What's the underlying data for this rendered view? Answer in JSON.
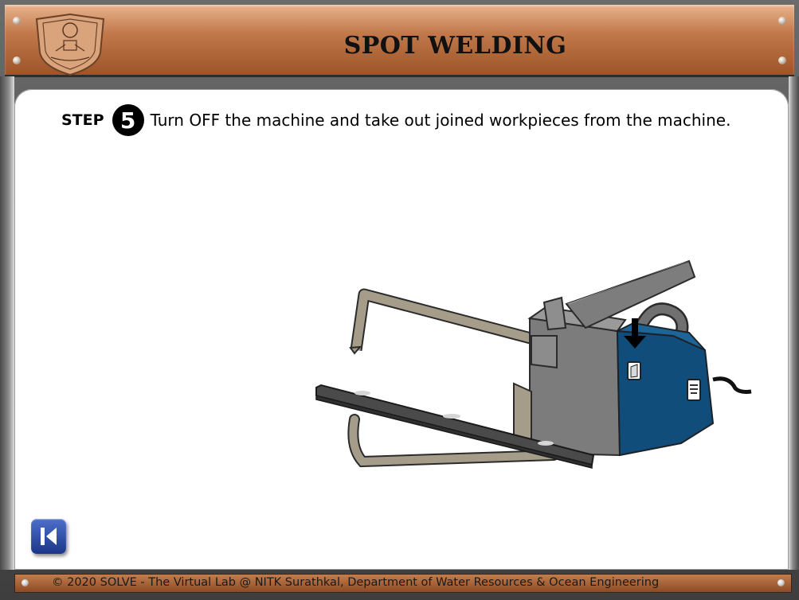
{
  "header": {
    "title": "SPOT WELDING",
    "logo_icon": "nitk-logo"
  },
  "instruction": {
    "step_label": "STEP",
    "step_number": "5",
    "text": "Turn OFF the machine and take out joined workpieces from the machine."
  },
  "illustration": {
    "icon": "spot-welding-machine",
    "switch_state": "off",
    "indicator": "down-arrow-icon"
  },
  "navigation": {
    "back_button_icon": "previous-icon"
  },
  "footer": {
    "text": "© 2020 SOLVE - The Virtual Lab @ NITK Surathkal, Department of Water Resources & Ocean Engineering"
  },
  "colors": {
    "header_brown": "#c27a4c",
    "machine_blue": "#114d7a",
    "button_blue": "#2c47a3"
  }
}
